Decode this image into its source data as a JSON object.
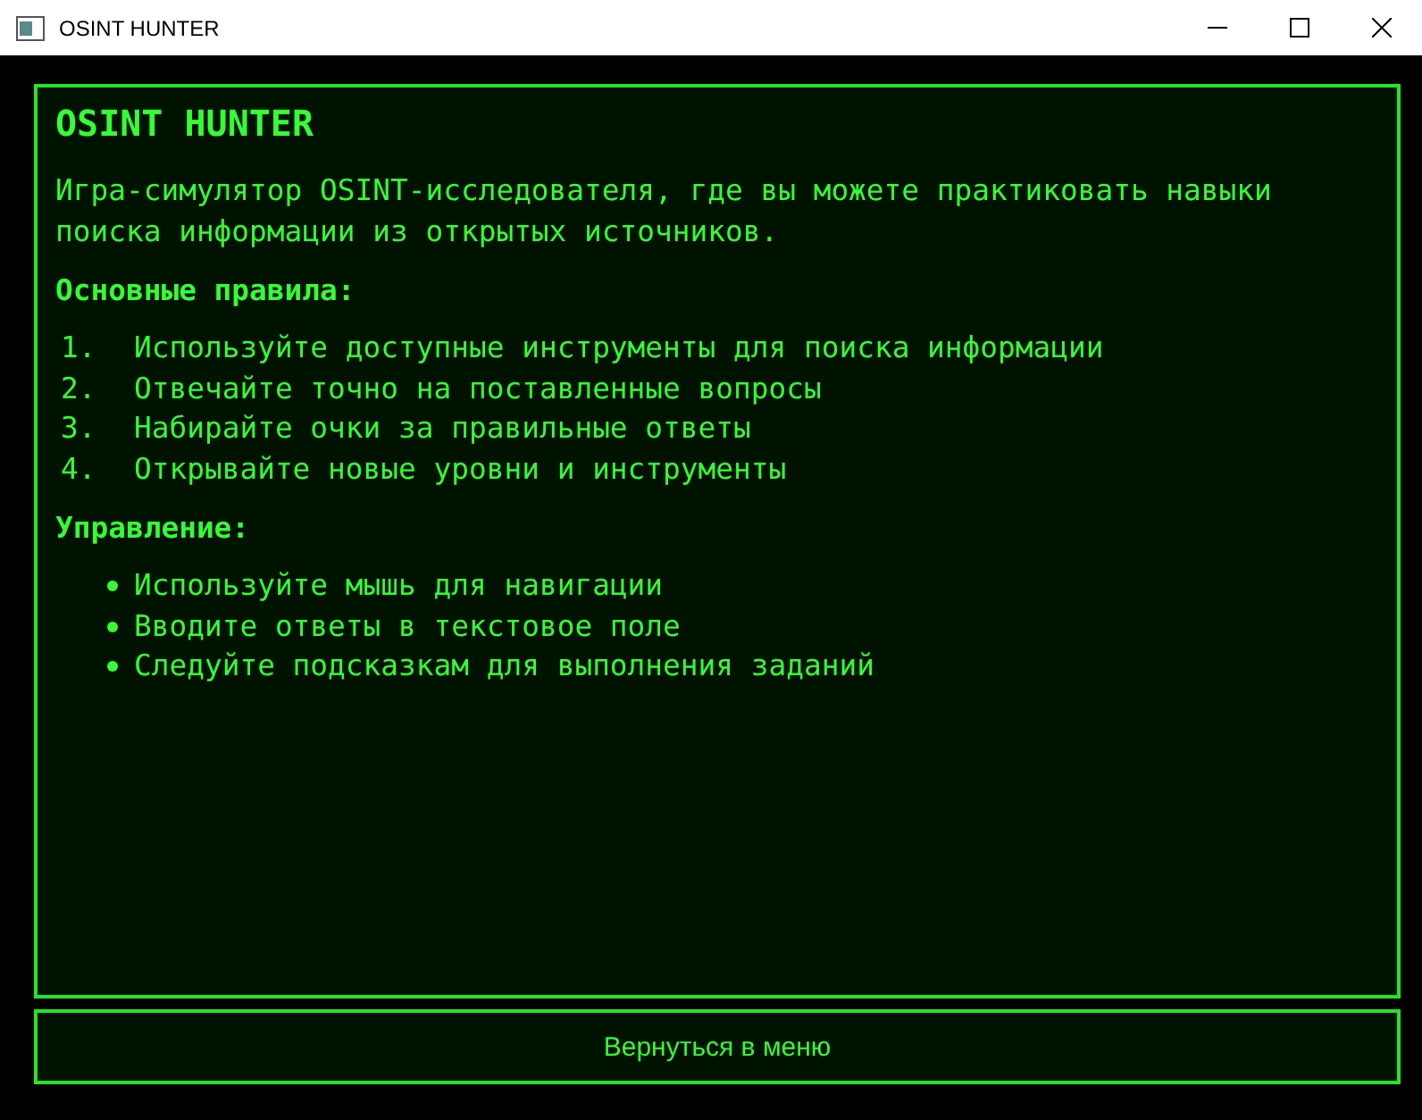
{
  "window": {
    "title": "OSINT HUNTER"
  },
  "panel": {
    "title": "OSINT HUNTER",
    "intro": "Игра-симулятор OSINT-исследователя, где вы можете практиковать навыки поиска информации из открытых источников.",
    "sections": [
      {
        "heading": "Основные правила:",
        "kind": "numbered",
        "items": [
          {
            "number": "1.",
            "text": "Используйте доступные инструменты для поиска информации"
          },
          {
            "number": "2.",
            "text": "Отвечайте точно на поставленные вопросы"
          },
          {
            "number": "3.",
            "text": "Набирайте очки за правильные ответы"
          },
          {
            "number": "4.",
            "text": "Открывайте новые уровни и инструменты"
          }
        ]
      },
      {
        "heading": "Управление:",
        "kind": "bulleted",
        "items": [
          {
            "text": "Используйте мышь для навигации"
          },
          {
            "text": "Вводите ответы в текстовое поле"
          },
          {
            "text": "Следуйте подсказкам для выполнения заданий"
          }
        ]
      }
    ]
  },
  "button": {
    "label": "Вернуться в меню"
  }
}
